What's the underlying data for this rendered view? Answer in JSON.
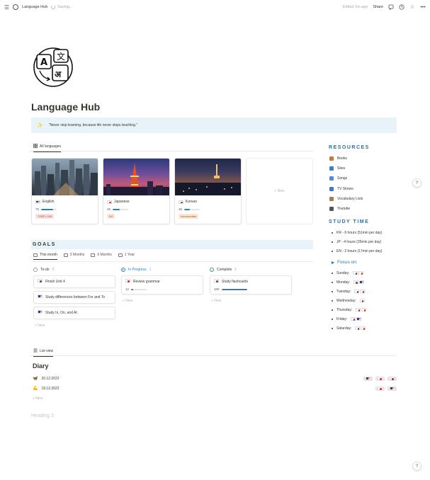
{
  "topbar": {
    "page_name": "Language Hub",
    "saving": "Saving...",
    "edited": "Edited 1m ago",
    "share": "Share",
    "icons": [
      "menu-icon",
      "globe-icon",
      "comment-icon",
      "clock-icon",
      "star-icon",
      "more-icon"
    ]
  },
  "page": {
    "title": "Language Hub",
    "quote": "\"Never stop learning, because life never stops teaching.\"",
    "quote_icon": "sparkle-icon",
    "page_icon": "translate-icon"
  },
  "languages_view": {
    "tab_label": "All languages",
    "new_label": "+ New",
    "cards": [
      {
        "name": "English",
        "flag": "us",
        "progress": 75,
        "tag": "TOEFL 100",
        "tag_color": "#f9e1e1",
        "tag_text_color": "#b03a3a",
        "image": "city-skyline-dusk"
      },
      {
        "name": "Japanese",
        "flag": "jp",
        "progress": 45,
        "tag": "N3",
        "tag_color": "#fbe4d8",
        "tag_text_color": "#b5532a",
        "image": "tokyo-tower-night"
      },
      {
        "name": "Korean",
        "flag": "kr",
        "progress": 35,
        "tag": "Intermediate",
        "tag_color": "#fbe6d4",
        "tag_text_color": "#a15a2a",
        "image": "seoul-tower-night"
      }
    ]
  },
  "resources": {
    "heading": "RESOURCES",
    "items": [
      {
        "label": "Books",
        "icon": "books-icon",
        "color": "#c67a3f"
      },
      {
        "label": "Sites",
        "icon": "monitor-icon",
        "color": "#3b82c4"
      },
      {
        "label": "Songs",
        "icon": "music-icon",
        "color": "#4a90d9"
      },
      {
        "label": "TV Shows",
        "icon": "tv-icon",
        "color": "#3b7dc0"
      },
      {
        "label": "Vocabulary Lists",
        "icon": "notebook-icon",
        "color": "#a67c52"
      },
      {
        "label": "Youtube",
        "icon": "camera-icon",
        "color": "#555555"
      }
    ]
  },
  "study_time": {
    "heading": "STUDY TIME",
    "items": [
      "KR - 6 hours (51min per day)",
      "JP - 4 hours (35min per day)",
      "EN - 2 hours (17min per day)"
    ]
  },
  "focus": {
    "heading": "Focus on:",
    "days": [
      {
        "day": "Sunday:",
        "flags": [
          "kr",
          "jp"
        ]
      },
      {
        "day": "Monday:",
        "flags": [
          "kr",
          "us"
        ]
      },
      {
        "day": "Tuesday:",
        "flags": [
          "kr",
          "jp"
        ]
      },
      {
        "day": "Wednesday:",
        "flags": [
          "kr"
        ]
      },
      {
        "day": "Thursday:",
        "flags": [
          "kr",
          "jp"
        ]
      },
      {
        "day": "Friday:",
        "flags": [
          "kr",
          "us"
        ]
      },
      {
        "day": "Saturday:",
        "flags": [
          "kr",
          "jp"
        ]
      }
    ]
  },
  "goals": {
    "heading": "GOALS",
    "tabs": [
      "This month",
      "3 Months",
      "6 Months",
      "1 Year"
    ],
    "columns": [
      {
        "name": "To-do",
        "count": "3",
        "color": "#9b9a97",
        "cards": [
          {
            "title": "Finish Unit 4",
            "flag": "kr"
          },
          {
            "title": "Study differences between For and To",
            "flag": "us"
          },
          {
            "title": "Study In, On, and At",
            "flag": "us"
          }
        ]
      },
      {
        "name": "In Progress",
        "count": "1",
        "color": "#2f7dc1",
        "cards": [
          {
            "title": "Review grammar",
            "flag": "jp",
            "progress": 12
          }
        ]
      },
      {
        "name": "Complete",
        "count": "1",
        "color": "#4a9c6d",
        "cards": [
          {
            "title": "Study flashcards",
            "flag": "kr",
            "progress": 100
          }
        ]
      }
    ],
    "new_label": "+ New"
  },
  "diary": {
    "tab_label": "List view",
    "title": "Diary",
    "rows": [
      {
        "date": "20.12.2022",
        "icon": "butterfly-icon",
        "icon_color": "#3b6fc4",
        "tags": [
          "us",
          "jp",
          "kr"
        ]
      },
      {
        "date": "19.12.2022",
        "icon": "flexed-arm-icon",
        "icon_color": "#e0a63a",
        "tags": [
          "jp",
          "us"
        ]
      }
    ],
    "new_label": "+ New"
  },
  "placeholder_heading": "Heading 3",
  "help": "?"
}
